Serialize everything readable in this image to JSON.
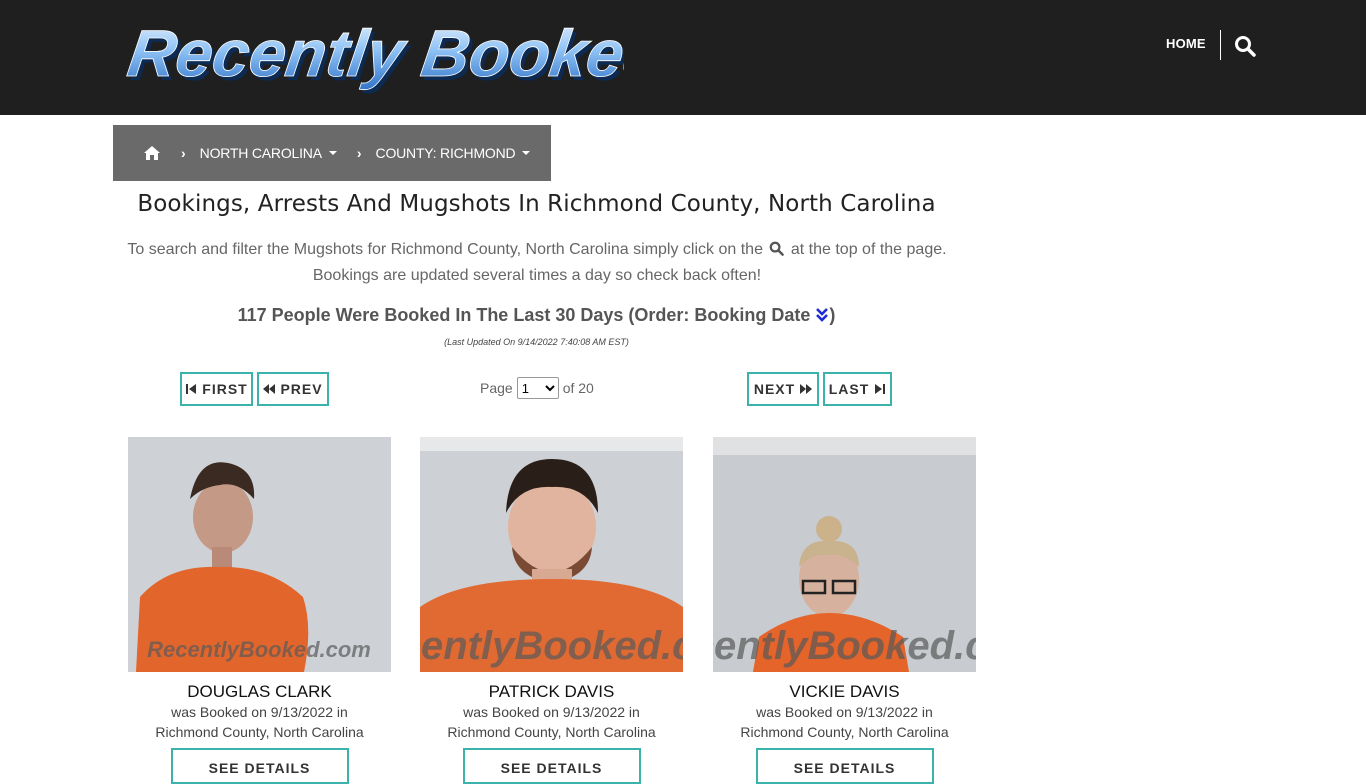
{
  "header": {
    "logo_text": "Recently Booked",
    "home_label": "HOME",
    "search_icon": "search-icon"
  },
  "breadcrumb": {
    "home_icon": "home-icon",
    "state": "NORTH CAROLINA",
    "county": "COUNTY: RICHMOND"
  },
  "page": {
    "title": "Bookings, Arrests And Mugshots In Richmond County, North Carolina",
    "intro_before": "To search and filter the Mugshots for Richmond County, North Carolina simply click on the",
    "intro_after": "at the top of the page. Bookings are updated several times a day so check back often!",
    "count_text": "117 People Were Booked In The Last 30 Days (Order: Booking Date",
    "count_close": ")",
    "last_updated": "(Last Updated On 9/14/2022 7:40:08 AM EST)"
  },
  "pager": {
    "first": "FIRST",
    "prev": "PREV",
    "next": "NEXT",
    "last": "LAST",
    "page_label": "Page",
    "current_page": "1",
    "of_label": "of 20"
  },
  "bookings": [
    {
      "name": "DOUGLAS CLARK",
      "booked": "was Booked on 9/13/2022 in",
      "place": "Richmond County, North Carolina",
      "button": "SEE DETAILS",
      "watermark": "RecentlyBooked.com"
    },
    {
      "name": "PATRICK DAVIS",
      "booked": "was Booked on 9/13/2022 in",
      "place": "Richmond County, North Carolina",
      "button": "SEE DETAILS",
      "watermark": "RecentlyBooked.com"
    },
    {
      "name": "VICKIE DAVIS",
      "booked": "was Booked on 9/13/2022 in",
      "place": "Richmond County, North Carolina",
      "button": "SEE DETAILS",
      "watermark": "RecentlyBooked.com"
    }
  ],
  "colors": {
    "header_bg": "#1f1f1f",
    "breadcrumb_bg": "#6a6a6a",
    "accent_border": "#3bb3ac",
    "order_icon": "#1e2bd6"
  }
}
